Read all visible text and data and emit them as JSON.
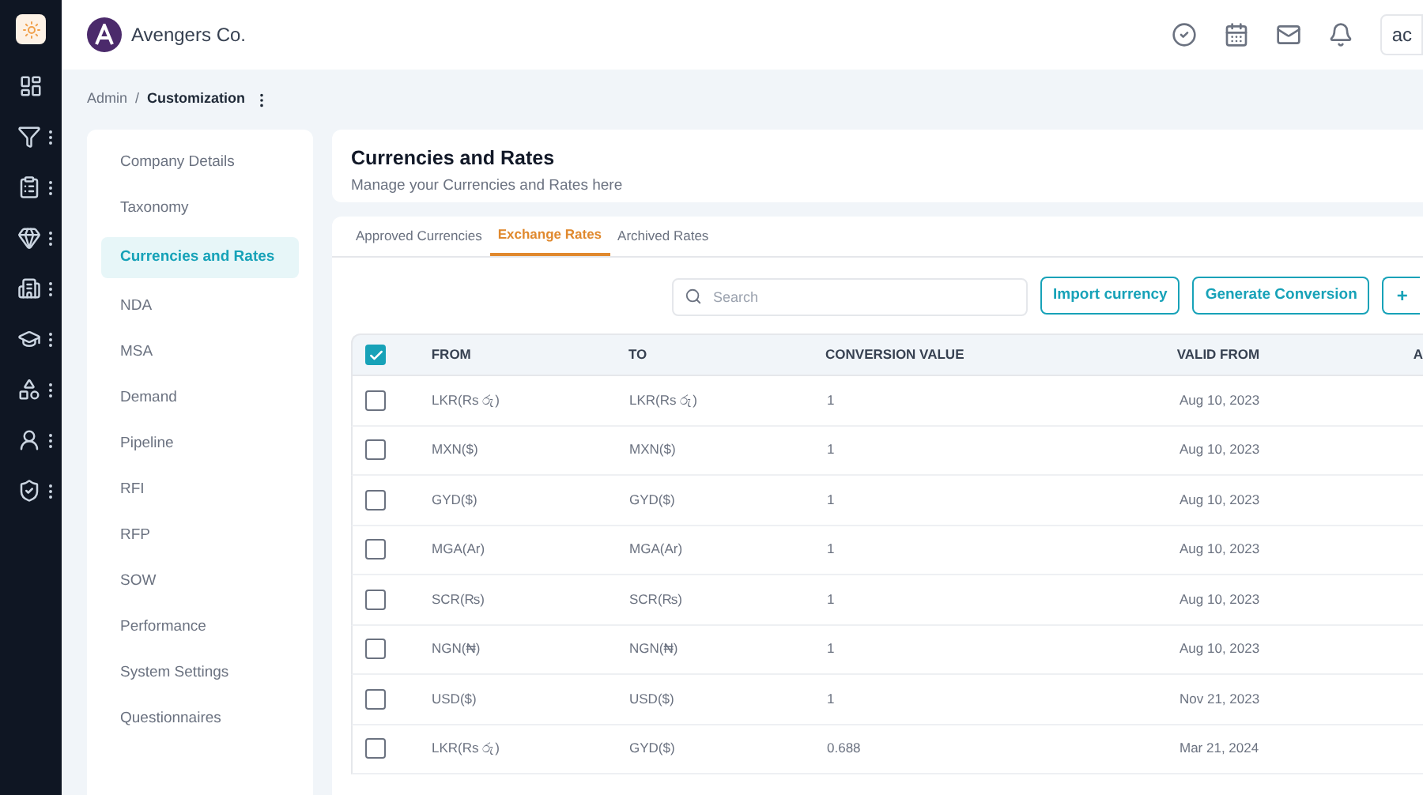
{
  "company": {
    "name": "Avengers Co."
  },
  "header": {
    "user_button": "ac"
  },
  "breadcrumb": {
    "parent": "Admin",
    "separator": "/",
    "current": "Customization"
  },
  "settings_nav": [
    {
      "label": "Company Details",
      "selected": false
    },
    {
      "label": "Taxonomy",
      "selected": false
    },
    {
      "label": "Currencies and Rates",
      "selected": true
    },
    {
      "label": "NDA",
      "selected": false
    },
    {
      "label": "MSA",
      "selected": false
    },
    {
      "label": "Demand",
      "selected": false
    },
    {
      "label": "Pipeline",
      "selected": false
    },
    {
      "label": "RFI",
      "selected": false
    },
    {
      "label": "RFP",
      "selected": false
    },
    {
      "label": "SOW",
      "selected": false
    },
    {
      "label": "Performance",
      "selected": false
    },
    {
      "label": "System Settings",
      "selected": false
    },
    {
      "label": "Questionnaires",
      "selected": false
    }
  ],
  "page": {
    "title": "Currencies and Rates",
    "subtitle": "Manage your Currencies and Rates here"
  },
  "tabs": [
    {
      "label": "Approved Currencies",
      "selected": false
    },
    {
      "label": "Exchange Rates",
      "selected": true
    },
    {
      "label": "Archived Rates",
      "selected": false
    }
  ],
  "toolbar": {
    "search_placeholder": "Search",
    "buttons": [
      "Import currency",
      "Generate Conversion"
    ],
    "add_button": "+"
  },
  "table": {
    "select_all_checked": true,
    "columns": [
      "FROM",
      "TO",
      "CONVERSION VALUE",
      "VALID FROM",
      "A"
    ],
    "rows": [
      {
        "checked": false,
        "from": "LKR(Rs රු)",
        "to": "LKR(Rs රු)",
        "value": "1",
        "valid_from": "Aug 10, 2023"
      },
      {
        "checked": false,
        "from": "MXN($)",
        "to": "MXN($)",
        "value": "1",
        "valid_from": "Aug 10, 2023"
      },
      {
        "checked": false,
        "from": "GYD($)",
        "to": "GYD($)",
        "value": "1",
        "valid_from": "Aug 10, 2023"
      },
      {
        "checked": false,
        "from": "MGA(Ar)",
        "to": "MGA(Ar)",
        "value": "1",
        "valid_from": "Aug 10, 2023"
      },
      {
        "checked": false,
        "from": "SCR(₨)",
        "to": "SCR(₨)",
        "value": "1",
        "valid_from": "Aug 10, 2023"
      },
      {
        "checked": false,
        "from": "NGN(₦)",
        "to": "NGN(₦)",
        "value": "1",
        "valid_from": "Aug 10, 2023"
      },
      {
        "checked": false,
        "from": "USD($)",
        "to": "USD($)",
        "value": "1",
        "valid_from": "Nov 21, 2023"
      },
      {
        "checked": false,
        "from": "LKR(Rs රු)",
        "to": "GYD($)",
        "value": "0.688",
        "valid_from": "Mar 21, 2024"
      }
    ]
  }
}
